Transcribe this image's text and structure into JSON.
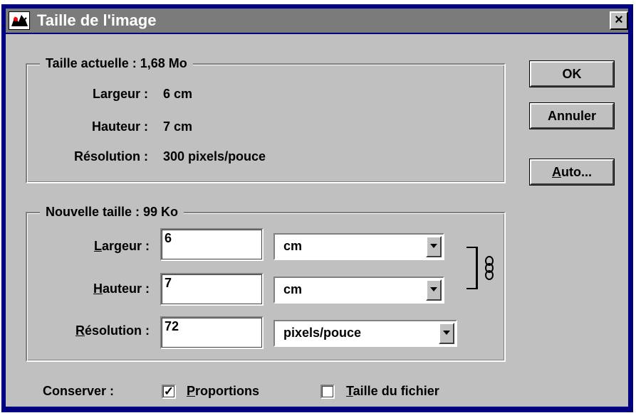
{
  "window": {
    "title": "Taille de l'image",
    "close_glyph": "×"
  },
  "current": {
    "legend": "Taille actuelle : 1,68 Mo",
    "width_label": "Largeur :",
    "width_value": "6 cm",
    "height_label": "Hauteur :",
    "height_value": "7 cm",
    "resolution_label": "Résolution :",
    "resolution_value": "300 pixels/pouce"
  },
  "new_size": {
    "legend": "Nouvelle taille : 99 Ko",
    "width": {
      "label_mnemonic": "L",
      "label_rest": "argeur :",
      "value": "6",
      "unit": "cm"
    },
    "height": {
      "label_mnemonic": "H",
      "label_rest": "auteur :",
      "value": "7",
      "unit": "cm"
    },
    "resolution": {
      "label_mnemonic": "R",
      "label_rest": "ésolution :",
      "value": "72",
      "unit": "pixels/pouce"
    },
    "link_icon": "chain-link-icon"
  },
  "buttons": {
    "ok": "OK",
    "cancel": "Annuler",
    "auto_mnemonic": "A",
    "auto_rest": "uto..."
  },
  "constrain": {
    "label": "Conserver :",
    "proportions": {
      "mnemonic": "P",
      "rest": "roportions",
      "checked": true,
      "mark": "✓"
    },
    "file_size": {
      "mnemonic": "T",
      "rest": "aille du fichier",
      "checked": false
    }
  }
}
